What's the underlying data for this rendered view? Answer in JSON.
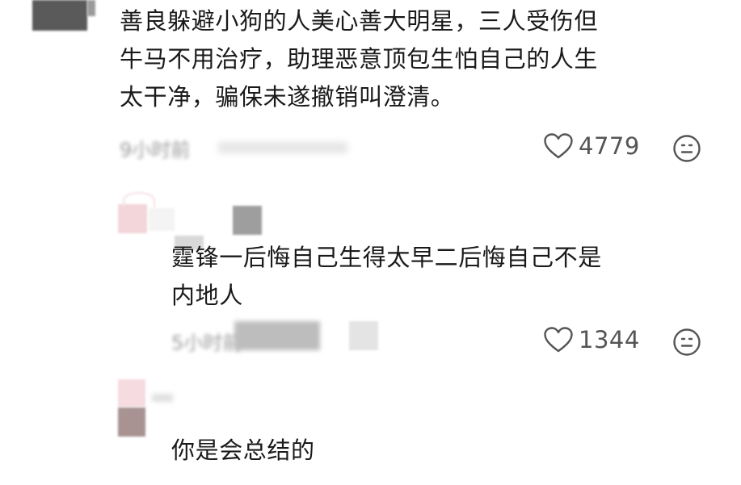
{
  "comments": [
    {
      "text_lines": [
        "善良躲避小狗的人美心善大明星，三人受伤但",
        "牛马不用治疗，助理恶意顶包生怕自己的人生",
        "太干净，骗保未遂撤销叫澄清。"
      ],
      "time": "9小时前",
      "likes": "4779"
    },
    {
      "text_lines": [
        "霆锋一后悔自己生得太早二后悔自己不是",
        "内地人"
      ],
      "time": "5小时前",
      "likes": "1344"
    },
    {
      "text_lines": [
        "你是会总结的"
      ]
    }
  ],
  "icons": {
    "like": "heart-outline-icon",
    "dislike": "neutral-face-icon"
  }
}
